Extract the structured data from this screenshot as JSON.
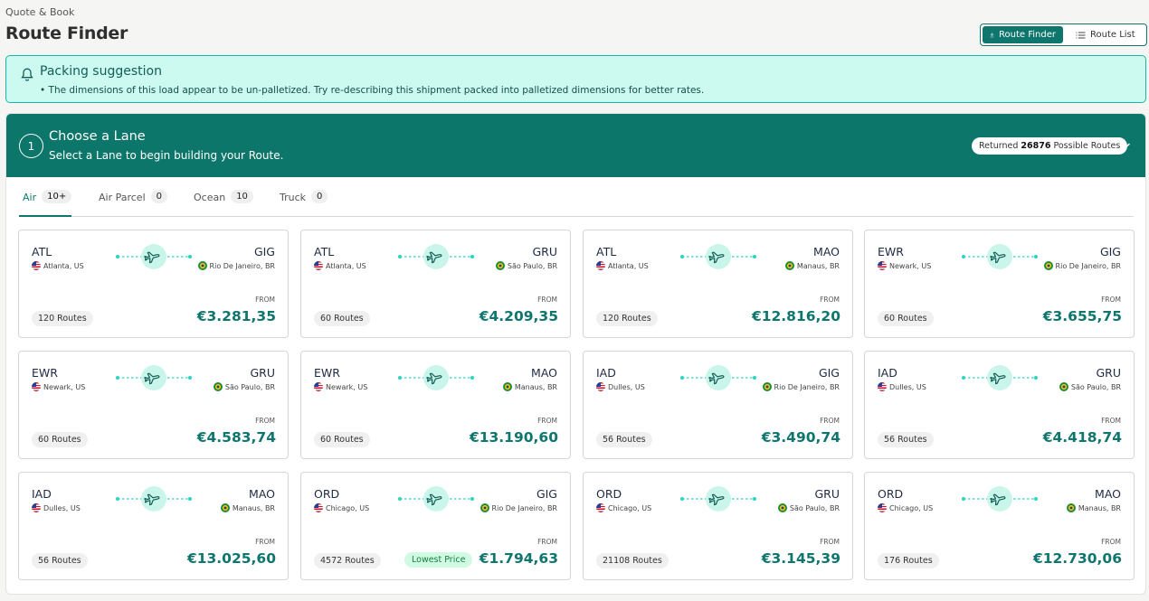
{
  "header": {
    "breadcrumb": "Quote & Book",
    "title": "Route Finder",
    "view_toggle": {
      "route_finder": "Route Finder",
      "route_list": "Route List"
    }
  },
  "alert": {
    "title": "Packing suggestion",
    "body": "• The dimensions of this load appear to be un-palletized. Try re-describing this shipment packed into palletized dimensions for better rates."
  },
  "lane": {
    "step": "1",
    "title": "Choose a Lane",
    "subtitle": "Select a Lane to begin building your Route.",
    "returned_prefix": "Returned",
    "returned_count": "26876",
    "returned_suffix": "Possible Routes"
  },
  "tabs": [
    {
      "label": "Air",
      "count": "10+"
    },
    {
      "label": "Air Parcel",
      "count": "0"
    },
    {
      "label": "Ocean",
      "count": "10"
    },
    {
      "label": "Truck",
      "count": "0"
    }
  ],
  "from_label": "FROM",
  "lowest_label": "Lowest Price",
  "cards": [
    {
      "origin": "ATL",
      "origin_city": "Atlanta, US",
      "dest": "GIG",
      "dest_city": "Rio De Janeiro, BR",
      "routes": "120 Routes",
      "price": "€3.281,35"
    },
    {
      "origin": "ATL",
      "origin_city": "Atlanta, US",
      "dest": "GRU",
      "dest_city": "São Paulo, BR",
      "routes": "60 Routes",
      "price": "€4.209,35"
    },
    {
      "origin": "ATL",
      "origin_city": "Atlanta, US",
      "dest": "MAO",
      "dest_city": "Manaus, BR",
      "routes": "120 Routes",
      "price": "€12.816,20"
    },
    {
      "origin": "EWR",
      "origin_city": "Newark, US",
      "dest": "GIG",
      "dest_city": "Rio De Janeiro, BR",
      "routes": "60 Routes",
      "price": "€3.655,75"
    },
    {
      "origin": "EWR",
      "origin_city": "Newark, US",
      "dest": "GRU",
      "dest_city": "São Paulo, BR",
      "routes": "60 Routes",
      "price": "€4.583,74"
    },
    {
      "origin": "EWR",
      "origin_city": "Newark, US",
      "dest": "MAO",
      "dest_city": "Manaus, BR",
      "routes": "60 Routes",
      "price": "€13.190,60"
    },
    {
      "origin": "IAD",
      "origin_city": "Dulles, US",
      "dest": "GIG",
      "dest_city": "Rio De Janeiro, BR",
      "routes": "56 Routes",
      "price": "€3.490,74"
    },
    {
      "origin": "IAD",
      "origin_city": "Dulles, US",
      "dest": "GRU",
      "dest_city": "São Paulo, BR",
      "routes": "56 Routes",
      "price": "€4.418,74"
    },
    {
      "origin": "IAD",
      "origin_city": "Dulles, US",
      "dest": "MAO",
      "dest_city": "Manaus, BR",
      "routes": "56 Routes",
      "price": "€13.025,60"
    },
    {
      "origin": "ORD",
      "origin_city": "Chicago, US",
      "dest": "GIG",
      "dest_city": "Rio De Janeiro, BR",
      "routes": "4572 Routes",
      "price": "€1.794,63",
      "lowest": true
    },
    {
      "origin": "ORD",
      "origin_city": "Chicago, US",
      "dest": "GRU",
      "dest_city": "São Paulo, BR",
      "routes": "21108 Routes",
      "price": "€3.145,39"
    },
    {
      "origin": "ORD",
      "origin_city": "Chicago, US",
      "dest": "MAO",
      "dest_city": "Manaus, BR",
      "routes": "176 Routes",
      "price": "€12.730,06"
    }
  ],
  "colors": {
    "accent": "#0f766e",
    "header": "#0b7669",
    "alert_bg": "#ccfaf0",
    "price": "#0f766e"
  },
  "icons": {
    "bell": "bell-icon",
    "chevron": "chevron-down-icon",
    "plane": "airplane-icon",
    "list": "list-icon",
    "route": "route-pin-icon"
  }
}
